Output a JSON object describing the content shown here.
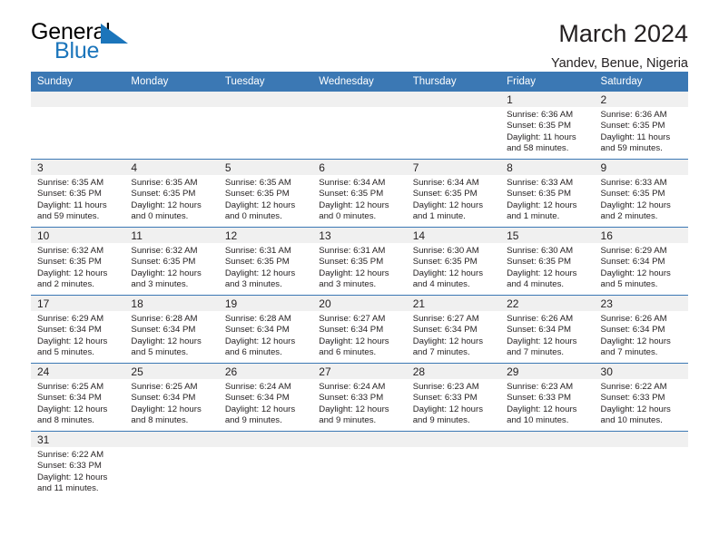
{
  "brand": {
    "name_part1": "General",
    "name_part2": "Blue",
    "logo_icon": "blue-flag-triangle"
  },
  "header": {
    "title": "March 2024",
    "subtitle": "Yandev, Benue, Nigeria"
  },
  "colors": {
    "header_blue": "#3b78b4",
    "logo_blue": "#1b75bb",
    "daynum_band": "#f0f0f0",
    "text": "#231f20"
  },
  "weekday_headers": [
    "Sunday",
    "Monday",
    "Tuesday",
    "Wednesday",
    "Thursday",
    "Friday",
    "Saturday"
  ],
  "weeks": [
    [
      {
        "day": "",
        "sunrise": "",
        "sunset": "",
        "daylight_line1": "",
        "daylight_line2": ""
      },
      {
        "day": "",
        "sunrise": "",
        "sunset": "",
        "daylight_line1": "",
        "daylight_line2": ""
      },
      {
        "day": "",
        "sunrise": "",
        "sunset": "",
        "daylight_line1": "",
        "daylight_line2": ""
      },
      {
        "day": "",
        "sunrise": "",
        "sunset": "",
        "daylight_line1": "",
        "daylight_line2": ""
      },
      {
        "day": "",
        "sunrise": "",
        "sunset": "",
        "daylight_line1": "",
        "daylight_line2": ""
      },
      {
        "day": "1",
        "sunrise": "Sunrise: 6:36 AM",
        "sunset": "Sunset: 6:35 PM",
        "daylight_line1": "Daylight: 11 hours",
        "daylight_line2": "and 58 minutes."
      },
      {
        "day": "2",
        "sunrise": "Sunrise: 6:36 AM",
        "sunset": "Sunset: 6:35 PM",
        "daylight_line1": "Daylight: 11 hours",
        "daylight_line2": "and 59 minutes."
      }
    ],
    [
      {
        "day": "3",
        "sunrise": "Sunrise: 6:35 AM",
        "sunset": "Sunset: 6:35 PM",
        "daylight_line1": "Daylight: 11 hours",
        "daylight_line2": "and 59 minutes."
      },
      {
        "day": "4",
        "sunrise": "Sunrise: 6:35 AM",
        "sunset": "Sunset: 6:35 PM",
        "daylight_line1": "Daylight: 12 hours",
        "daylight_line2": "and 0 minutes."
      },
      {
        "day": "5",
        "sunrise": "Sunrise: 6:35 AM",
        "sunset": "Sunset: 6:35 PM",
        "daylight_line1": "Daylight: 12 hours",
        "daylight_line2": "and 0 minutes."
      },
      {
        "day": "6",
        "sunrise": "Sunrise: 6:34 AM",
        "sunset": "Sunset: 6:35 PM",
        "daylight_line1": "Daylight: 12 hours",
        "daylight_line2": "and 0 minutes."
      },
      {
        "day": "7",
        "sunrise": "Sunrise: 6:34 AM",
        "sunset": "Sunset: 6:35 PM",
        "daylight_line1": "Daylight: 12 hours",
        "daylight_line2": "and 1 minute."
      },
      {
        "day": "8",
        "sunrise": "Sunrise: 6:33 AM",
        "sunset": "Sunset: 6:35 PM",
        "daylight_line1": "Daylight: 12 hours",
        "daylight_line2": "and 1 minute."
      },
      {
        "day": "9",
        "sunrise": "Sunrise: 6:33 AM",
        "sunset": "Sunset: 6:35 PM",
        "daylight_line1": "Daylight: 12 hours",
        "daylight_line2": "and 2 minutes."
      }
    ],
    [
      {
        "day": "10",
        "sunrise": "Sunrise: 6:32 AM",
        "sunset": "Sunset: 6:35 PM",
        "daylight_line1": "Daylight: 12 hours",
        "daylight_line2": "and 2 minutes."
      },
      {
        "day": "11",
        "sunrise": "Sunrise: 6:32 AM",
        "sunset": "Sunset: 6:35 PM",
        "daylight_line1": "Daylight: 12 hours",
        "daylight_line2": "and 3 minutes."
      },
      {
        "day": "12",
        "sunrise": "Sunrise: 6:31 AM",
        "sunset": "Sunset: 6:35 PM",
        "daylight_line1": "Daylight: 12 hours",
        "daylight_line2": "and 3 minutes."
      },
      {
        "day": "13",
        "sunrise": "Sunrise: 6:31 AM",
        "sunset": "Sunset: 6:35 PM",
        "daylight_line1": "Daylight: 12 hours",
        "daylight_line2": "and 3 minutes."
      },
      {
        "day": "14",
        "sunrise": "Sunrise: 6:30 AM",
        "sunset": "Sunset: 6:35 PM",
        "daylight_line1": "Daylight: 12 hours",
        "daylight_line2": "and 4 minutes."
      },
      {
        "day": "15",
        "sunrise": "Sunrise: 6:30 AM",
        "sunset": "Sunset: 6:35 PM",
        "daylight_line1": "Daylight: 12 hours",
        "daylight_line2": "and 4 minutes."
      },
      {
        "day": "16",
        "sunrise": "Sunrise: 6:29 AM",
        "sunset": "Sunset: 6:34 PM",
        "daylight_line1": "Daylight: 12 hours",
        "daylight_line2": "and 5 minutes."
      }
    ],
    [
      {
        "day": "17",
        "sunrise": "Sunrise: 6:29 AM",
        "sunset": "Sunset: 6:34 PM",
        "daylight_line1": "Daylight: 12 hours",
        "daylight_line2": "and 5 minutes."
      },
      {
        "day": "18",
        "sunrise": "Sunrise: 6:28 AM",
        "sunset": "Sunset: 6:34 PM",
        "daylight_line1": "Daylight: 12 hours",
        "daylight_line2": "and 5 minutes."
      },
      {
        "day": "19",
        "sunrise": "Sunrise: 6:28 AM",
        "sunset": "Sunset: 6:34 PM",
        "daylight_line1": "Daylight: 12 hours",
        "daylight_line2": "and 6 minutes."
      },
      {
        "day": "20",
        "sunrise": "Sunrise: 6:27 AM",
        "sunset": "Sunset: 6:34 PM",
        "daylight_line1": "Daylight: 12 hours",
        "daylight_line2": "and 6 minutes."
      },
      {
        "day": "21",
        "sunrise": "Sunrise: 6:27 AM",
        "sunset": "Sunset: 6:34 PM",
        "daylight_line1": "Daylight: 12 hours",
        "daylight_line2": "and 7 minutes."
      },
      {
        "day": "22",
        "sunrise": "Sunrise: 6:26 AM",
        "sunset": "Sunset: 6:34 PM",
        "daylight_line1": "Daylight: 12 hours",
        "daylight_line2": "and 7 minutes."
      },
      {
        "day": "23",
        "sunrise": "Sunrise: 6:26 AM",
        "sunset": "Sunset: 6:34 PM",
        "daylight_line1": "Daylight: 12 hours",
        "daylight_line2": "and 7 minutes."
      }
    ],
    [
      {
        "day": "24",
        "sunrise": "Sunrise: 6:25 AM",
        "sunset": "Sunset: 6:34 PM",
        "daylight_line1": "Daylight: 12 hours",
        "daylight_line2": "and 8 minutes."
      },
      {
        "day": "25",
        "sunrise": "Sunrise: 6:25 AM",
        "sunset": "Sunset: 6:34 PM",
        "daylight_line1": "Daylight: 12 hours",
        "daylight_line2": "and 8 minutes."
      },
      {
        "day": "26",
        "sunrise": "Sunrise: 6:24 AM",
        "sunset": "Sunset: 6:34 PM",
        "daylight_line1": "Daylight: 12 hours",
        "daylight_line2": "and 9 minutes."
      },
      {
        "day": "27",
        "sunrise": "Sunrise: 6:24 AM",
        "sunset": "Sunset: 6:33 PM",
        "daylight_line1": "Daylight: 12 hours",
        "daylight_line2": "and 9 minutes."
      },
      {
        "day": "28",
        "sunrise": "Sunrise: 6:23 AM",
        "sunset": "Sunset: 6:33 PM",
        "daylight_line1": "Daylight: 12 hours",
        "daylight_line2": "and 9 minutes."
      },
      {
        "day": "29",
        "sunrise": "Sunrise: 6:23 AM",
        "sunset": "Sunset: 6:33 PM",
        "daylight_line1": "Daylight: 12 hours",
        "daylight_line2": "and 10 minutes."
      },
      {
        "day": "30",
        "sunrise": "Sunrise: 6:22 AM",
        "sunset": "Sunset: 6:33 PM",
        "daylight_line1": "Daylight: 12 hours",
        "daylight_line2": "and 10 minutes."
      }
    ],
    [
      {
        "day": "31",
        "sunrise": "Sunrise: 6:22 AM",
        "sunset": "Sunset: 6:33 PM",
        "daylight_line1": "Daylight: 12 hours",
        "daylight_line2": "and 11 minutes."
      },
      {
        "day": "",
        "sunrise": "",
        "sunset": "",
        "daylight_line1": "",
        "daylight_line2": ""
      },
      {
        "day": "",
        "sunrise": "",
        "sunset": "",
        "daylight_line1": "",
        "daylight_line2": ""
      },
      {
        "day": "",
        "sunrise": "",
        "sunset": "",
        "daylight_line1": "",
        "daylight_line2": ""
      },
      {
        "day": "",
        "sunrise": "",
        "sunset": "",
        "daylight_line1": "",
        "daylight_line2": ""
      },
      {
        "day": "",
        "sunrise": "",
        "sunset": "",
        "daylight_line1": "",
        "daylight_line2": ""
      },
      {
        "day": "",
        "sunrise": "",
        "sunset": "",
        "daylight_line1": "",
        "daylight_line2": ""
      }
    ]
  ]
}
